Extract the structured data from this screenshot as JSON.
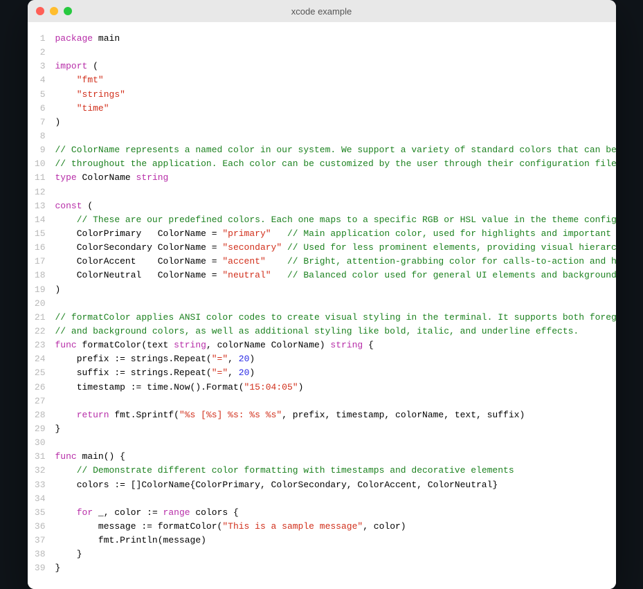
{
  "window": {
    "title": "xcode example"
  },
  "colors": {
    "keyword": "#b72da8",
    "string": "#d12f1b",
    "comment": "#1d8220",
    "number": "#2929e5",
    "text": "#000000",
    "lineno": "#b8b8b8"
  },
  "code": {
    "lines": [
      {
        "n": 1,
        "tokens": [
          [
            "kw",
            "package"
          ],
          [
            "txt",
            " main"
          ]
        ]
      },
      {
        "n": 2,
        "tokens": []
      },
      {
        "n": 3,
        "tokens": [
          [
            "kw",
            "import"
          ],
          [
            "txt",
            " ("
          ]
        ]
      },
      {
        "n": 4,
        "tokens": [
          [
            "txt",
            "    "
          ],
          [
            "str",
            "\"fmt\""
          ]
        ]
      },
      {
        "n": 5,
        "tokens": [
          [
            "txt",
            "    "
          ],
          [
            "str",
            "\"strings\""
          ]
        ]
      },
      {
        "n": 6,
        "tokens": [
          [
            "txt",
            "    "
          ],
          [
            "str",
            "\"time\""
          ]
        ]
      },
      {
        "n": 7,
        "tokens": [
          [
            "txt",
            ")"
          ]
        ]
      },
      {
        "n": 8,
        "tokens": []
      },
      {
        "n": 9,
        "tokens": [
          [
            "com",
            "// ColorName represents a named color in our system. We support a variety of standard colors that can be used"
          ]
        ]
      },
      {
        "n": 10,
        "tokens": [
          [
            "com",
            "// throughout the application. Each color can be customized by the user through their configuration file."
          ]
        ]
      },
      {
        "n": 11,
        "tokens": [
          [
            "kw",
            "type"
          ],
          [
            "txt",
            " ColorName "
          ],
          [
            "kw",
            "string"
          ]
        ]
      },
      {
        "n": 12,
        "tokens": []
      },
      {
        "n": 13,
        "tokens": [
          [
            "kw",
            "const"
          ],
          [
            "txt",
            " ("
          ]
        ]
      },
      {
        "n": 14,
        "tokens": [
          [
            "txt",
            "    "
          ],
          [
            "com",
            "// These are our predefined colors. Each one maps to a specific RGB or HSL value in the theme configuration."
          ]
        ]
      },
      {
        "n": 15,
        "tokens": [
          [
            "txt",
            "    ColorPrimary   ColorName = "
          ],
          [
            "str",
            "\"primary\""
          ],
          [
            "txt",
            "   "
          ],
          [
            "com",
            "// Main application color, used for highlights and important UI elements"
          ]
        ]
      },
      {
        "n": 16,
        "tokens": [
          [
            "txt",
            "    ColorSecondary ColorName = "
          ],
          [
            "str",
            "\"secondary\""
          ],
          [
            "txt",
            " "
          ],
          [
            "com",
            "// Used for less prominent elements, providing visual hierarchy"
          ]
        ]
      },
      {
        "n": 17,
        "tokens": [
          [
            "txt",
            "    ColorAccent    ColorName = "
          ],
          [
            "str",
            "\"accent\""
          ],
          [
            "txt",
            "    "
          ],
          [
            "com",
            "// Bright, attention-grabbing color for calls-to-action and highlights"
          ]
        ]
      },
      {
        "n": 18,
        "tokens": [
          [
            "txt",
            "    ColorNeutral   ColorName = "
          ],
          [
            "str",
            "\"neutral\""
          ],
          [
            "txt",
            "   "
          ],
          [
            "com",
            "// Balanced color used for general UI elements and backgrounds"
          ]
        ]
      },
      {
        "n": 19,
        "tokens": [
          [
            "txt",
            ")"
          ]
        ]
      },
      {
        "n": 20,
        "tokens": []
      },
      {
        "n": 21,
        "tokens": [
          [
            "com",
            "// formatColor applies ANSI color codes to create visual styling in the terminal. It supports both foreground"
          ]
        ]
      },
      {
        "n": 22,
        "tokens": [
          [
            "com",
            "// and background colors, as well as additional styling like bold, italic, and underline effects."
          ]
        ]
      },
      {
        "n": 23,
        "tokens": [
          [
            "kw",
            "func"
          ],
          [
            "txt",
            " formatColor(text "
          ],
          [
            "kw",
            "string"
          ],
          [
            "txt",
            ", colorName ColorName) "
          ],
          [
            "kw",
            "string"
          ],
          [
            "txt",
            " {"
          ]
        ]
      },
      {
        "n": 24,
        "tokens": [
          [
            "txt",
            "    prefix := strings.Repeat("
          ],
          [
            "str",
            "\"=\""
          ],
          [
            "txt",
            ", "
          ],
          [
            "num",
            "20"
          ],
          [
            "txt",
            ")"
          ]
        ]
      },
      {
        "n": 25,
        "tokens": [
          [
            "txt",
            "    suffix := strings.Repeat("
          ],
          [
            "str",
            "\"=\""
          ],
          [
            "txt",
            ", "
          ],
          [
            "num",
            "20"
          ],
          [
            "txt",
            ")"
          ]
        ]
      },
      {
        "n": 26,
        "tokens": [
          [
            "txt",
            "    timestamp := time.Now().Format("
          ],
          [
            "str",
            "\"15:04:05\""
          ],
          [
            "txt",
            ")"
          ]
        ]
      },
      {
        "n": 27,
        "tokens": []
      },
      {
        "n": 28,
        "tokens": [
          [
            "txt",
            "    "
          ],
          [
            "kw",
            "return"
          ],
          [
            "txt",
            " fmt.Sprintf("
          ],
          [
            "str",
            "\"%s [%s] %s: %s %s\""
          ],
          [
            "txt",
            ", prefix, timestamp, colorName, text, suffix)"
          ]
        ]
      },
      {
        "n": 29,
        "tokens": [
          [
            "txt",
            "}"
          ]
        ]
      },
      {
        "n": 30,
        "tokens": []
      },
      {
        "n": 31,
        "tokens": [
          [
            "kw",
            "func"
          ],
          [
            "txt",
            " main() {"
          ]
        ]
      },
      {
        "n": 32,
        "tokens": [
          [
            "txt",
            "    "
          ],
          [
            "com",
            "// Demonstrate different color formatting with timestamps and decorative elements"
          ]
        ]
      },
      {
        "n": 33,
        "tokens": [
          [
            "txt",
            "    colors := []ColorName{ColorPrimary, ColorSecondary, ColorAccent, ColorNeutral}"
          ]
        ]
      },
      {
        "n": 34,
        "tokens": []
      },
      {
        "n": 35,
        "tokens": [
          [
            "txt",
            "    "
          ],
          [
            "kw",
            "for"
          ],
          [
            "txt",
            " _, color := "
          ],
          [
            "kw",
            "range"
          ],
          [
            "txt",
            " colors {"
          ]
        ]
      },
      {
        "n": 36,
        "tokens": [
          [
            "txt",
            "        message := formatColor("
          ],
          [
            "str",
            "\"This is a sample message\""
          ],
          [
            "txt",
            ", color)"
          ]
        ]
      },
      {
        "n": 37,
        "tokens": [
          [
            "txt",
            "        fmt.Println(message)"
          ]
        ]
      },
      {
        "n": 38,
        "tokens": [
          [
            "txt",
            "    }"
          ]
        ]
      },
      {
        "n": 39,
        "tokens": [
          [
            "txt",
            "}"
          ]
        ]
      }
    ]
  }
}
